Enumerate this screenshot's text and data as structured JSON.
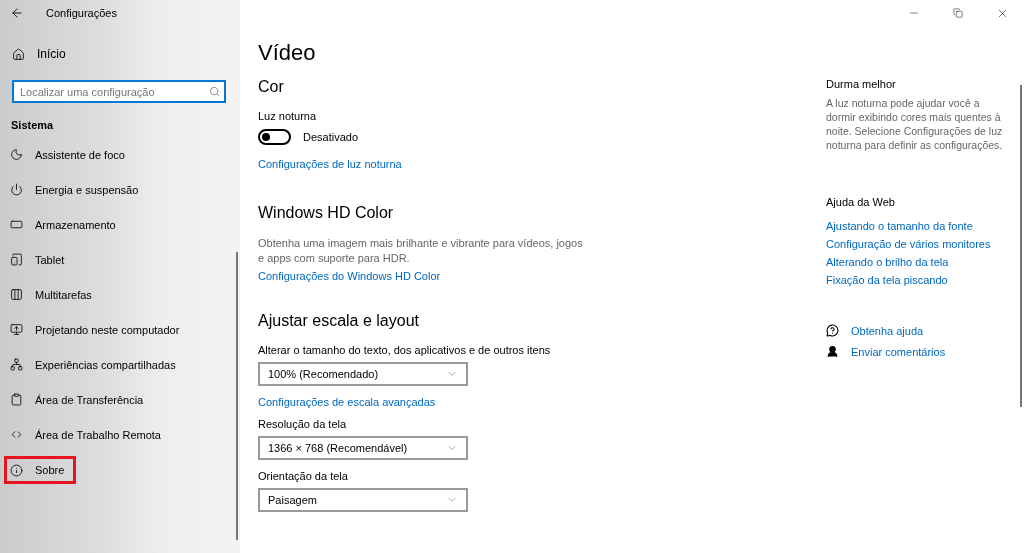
{
  "window": {
    "title": "Configurações"
  },
  "sidebar": {
    "home": "Início",
    "search": {
      "placeholder": "Localizar uma configuração"
    },
    "section": "Sistema",
    "items": [
      {
        "label": "Assistente de foco",
        "highlighted": false
      },
      {
        "label": "Energia e suspensão",
        "highlighted": false
      },
      {
        "label": "Armazenamento",
        "highlighted": false
      },
      {
        "label": "Tablet",
        "highlighted": false
      },
      {
        "label": "Multitarefas",
        "highlighted": false
      },
      {
        "label": "Projetando neste computador",
        "highlighted": false
      },
      {
        "label": "Experiências compartilhadas",
        "highlighted": false
      },
      {
        "label": "Área de Transferência",
        "highlighted": false
      },
      {
        "label": "Área de Trabalho Remota",
        "highlighted": false
      },
      {
        "label": "Sobre",
        "highlighted": true
      }
    ]
  },
  "main": {
    "title": "Vídeo",
    "color": {
      "heading": "Cor",
      "night_light": {
        "label": "Luz noturna",
        "on": false,
        "state": "Desativado"
      },
      "link": "Configurações de luz noturna"
    },
    "hd": {
      "heading": "Windows HD Color",
      "description": "Obtenha uma imagem mais brilhante e vibrante para vídeos, jogos e apps com suporte para HDR.",
      "link": "Configurações do Windows HD Color"
    },
    "scale": {
      "heading": "Ajustar escala e layout",
      "fields": [
        {
          "label": "Alterar o tamanho do texto, dos aplicativos e de outros itens",
          "value": "100% (Recomendado)",
          "link": "Configurações de escala avançadas"
        },
        {
          "label": "Resolução da tela",
          "value": "1366 × 768 (Recomendável)"
        },
        {
          "label": "Orientação da tela",
          "value": "Paisagem"
        }
      ]
    }
  },
  "aside": {
    "sleep": {
      "heading": "Durma melhor",
      "text": "A luz noturna pode ajudar você a dormir exibindo cores mais quentes à noite. Selecione Configurações de luz noturna para definir as configurações."
    },
    "web": {
      "heading": "Ajuda da Web",
      "links": [
        "Ajustando o tamanho da fonte",
        "Configuração de vários monitores",
        "Alterando o brilho da tela",
        "Fixação da tela piscando"
      ]
    },
    "actions": [
      "Obtenha ajuda",
      "Enviar comentários"
    ]
  }
}
